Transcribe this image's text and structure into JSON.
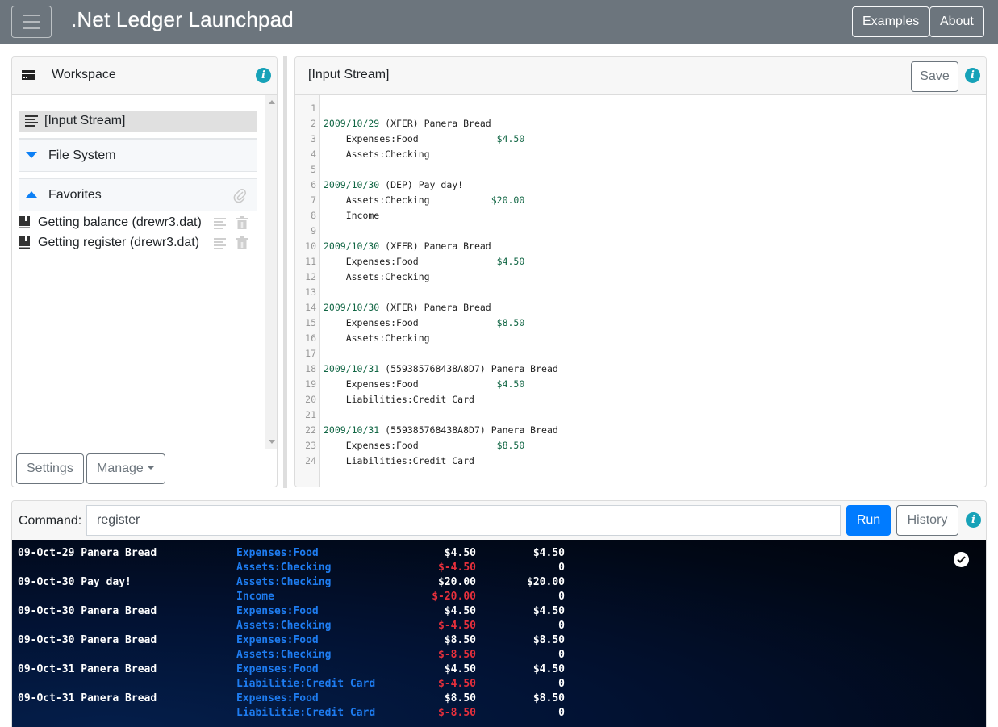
{
  "navbar": {
    "title": ".Net Ledger Launchpad",
    "examples_label": "Examples",
    "about_label": "About"
  },
  "workspace": {
    "title": "Workspace",
    "input_stream_label": "[Input Stream]",
    "file_system_label": "File System",
    "favorites_label": "Favorites",
    "favorites": [
      {
        "label": "Getting balance (drewr3.dat)"
      },
      {
        "label": "Getting register (drewr3.dat)"
      }
    ],
    "settings_label": "Settings",
    "manage_label": "Manage"
  },
  "editor": {
    "title": "[Input Stream]",
    "save_label": "Save",
    "lines": [
      {
        "n": "1",
        "date": "",
        "text": "",
        "amount": ""
      },
      {
        "n": "2",
        "date": "2009/10/29",
        "text": " (XFER) Panera Bread",
        "amount": ""
      },
      {
        "n": "3",
        "date": "",
        "text": "    Expenses:Food              ",
        "amount": "$4.50"
      },
      {
        "n": "4",
        "date": "",
        "text": "    Assets:Checking",
        "amount": ""
      },
      {
        "n": "5",
        "date": "",
        "text": "",
        "amount": ""
      },
      {
        "n": "6",
        "date": "2009/10/30",
        "text": " (DEP) Pay day!",
        "amount": ""
      },
      {
        "n": "7",
        "date": "",
        "text": "    Assets:Checking           ",
        "amount": "$20.00"
      },
      {
        "n": "8",
        "date": "",
        "text": "    Income",
        "amount": ""
      },
      {
        "n": "9",
        "date": "",
        "text": "",
        "amount": ""
      },
      {
        "n": "10",
        "date": "2009/10/30",
        "text": " (XFER) Panera Bread",
        "amount": ""
      },
      {
        "n": "11",
        "date": "",
        "text": "    Expenses:Food              ",
        "amount": "$4.50"
      },
      {
        "n": "12",
        "date": "",
        "text": "    Assets:Checking",
        "amount": ""
      },
      {
        "n": "13",
        "date": "",
        "text": "",
        "amount": ""
      },
      {
        "n": "14",
        "date": "2009/10/30",
        "text": " (XFER) Panera Bread",
        "amount": ""
      },
      {
        "n": "15",
        "date": "",
        "text": "    Expenses:Food              ",
        "amount": "$8.50"
      },
      {
        "n": "16",
        "date": "",
        "text": "    Assets:Checking",
        "amount": ""
      },
      {
        "n": "17",
        "date": "",
        "text": "",
        "amount": ""
      },
      {
        "n": "18",
        "date": "2009/10/31",
        "text": " (559385768438A8D7) Panera Bread",
        "amount": ""
      },
      {
        "n": "19",
        "date": "",
        "text": "    Expenses:Food              ",
        "amount": "$4.50"
      },
      {
        "n": "20",
        "date": "",
        "text": "    Liabilities:Credit Card",
        "amount": ""
      },
      {
        "n": "21",
        "date": "",
        "text": "",
        "amount": ""
      },
      {
        "n": "22",
        "date": "2009/10/31",
        "text": " (559385768438A8D7) Panera Bread",
        "amount": ""
      },
      {
        "n": "23",
        "date": "",
        "text": "    Expenses:Food              ",
        "amount": "$8.50"
      },
      {
        "n": "24",
        "date": "",
        "text": "    Liabilities:Credit Card",
        "amount": ""
      }
    ]
  },
  "command": {
    "label": "Command:",
    "value": "register",
    "run_label": "Run",
    "history_label": "History"
  },
  "output": {
    "rows": [
      {
        "payee": "09-Oct-29 Panera Bread",
        "account": "Expenses:Food",
        "amount": "$4.50",
        "amount_negative": false,
        "total": "$4.50"
      },
      {
        "payee": "",
        "account": "Assets:Checking",
        "amount": "$-4.50",
        "amount_negative": true,
        "total": "0"
      },
      {
        "payee": "09-Oct-30 Pay day!",
        "account": "Assets:Checking",
        "amount": "$20.00",
        "amount_negative": false,
        "total": "$20.00"
      },
      {
        "payee": "",
        "account": "Income",
        "amount": "$-20.00",
        "amount_negative": true,
        "total": "0"
      },
      {
        "payee": "09-Oct-30 Panera Bread",
        "account": "Expenses:Food",
        "amount": "$4.50",
        "amount_negative": false,
        "total": "$4.50"
      },
      {
        "payee": "",
        "account": "Assets:Checking",
        "amount": "$-4.50",
        "amount_negative": true,
        "total": "0"
      },
      {
        "payee": "09-Oct-30 Panera Bread",
        "account": "Expenses:Food",
        "amount": "$8.50",
        "amount_negative": false,
        "total": "$8.50"
      },
      {
        "payee": "",
        "account": "Assets:Checking",
        "amount": "$-8.50",
        "amount_negative": true,
        "total": "0"
      },
      {
        "payee": "09-Oct-31 Panera Bread",
        "account": "Expenses:Food",
        "amount": "$4.50",
        "amount_negative": false,
        "total": "$4.50"
      },
      {
        "payee": "",
        "account": "Liabilitie:Credit Card",
        "amount": "$-4.50",
        "amount_negative": true,
        "total": "0"
      },
      {
        "payee": "09-Oct-31 Panera Bread",
        "account": "Expenses:Food",
        "amount": "$8.50",
        "amount_negative": false,
        "total": "$8.50"
      },
      {
        "payee": "",
        "account": "Liabilitie:Credit Card",
        "amount": "$-8.50",
        "amount_negative": true,
        "total": "0"
      }
    ]
  },
  "colors": {
    "navbar": "#6c757d",
    "primary": "#007bff",
    "info": "#17a2b8",
    "account_blue": "#1e7cf0",
    "negative_red": "#e8303c",
    "code_green": "#116644"
  }
}
